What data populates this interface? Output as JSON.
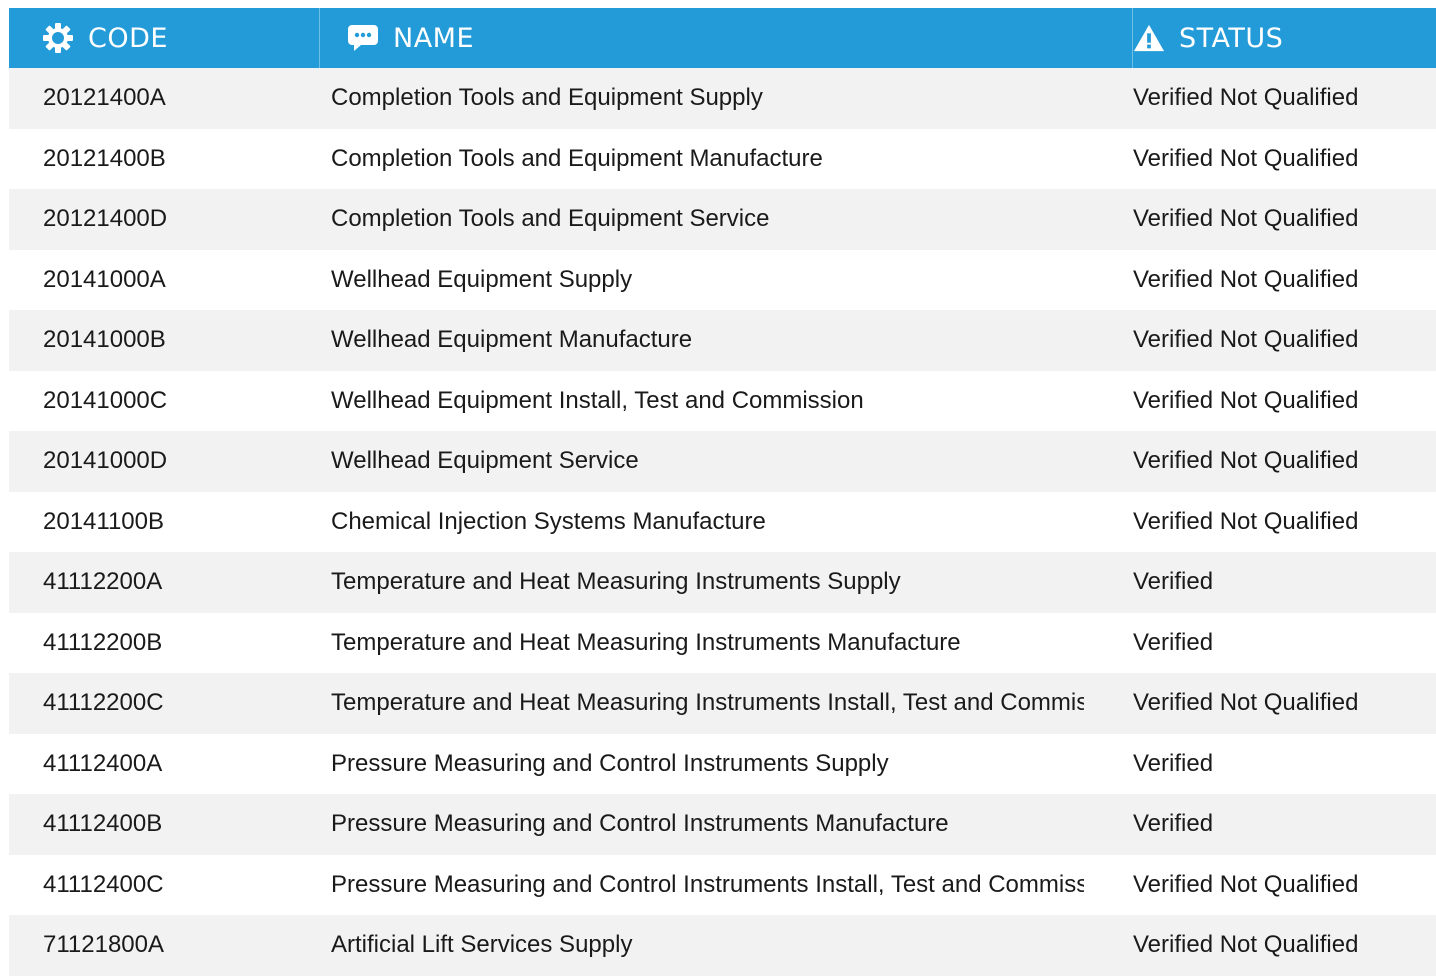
{
  "header": {
    "code_label": "CODE",
    "name_label": "NAME",
    "status_label": "STATUS",
    "code_icon": "gear-icon",
    "name_icon": "chat-bubble-icon",
    "status_icon": "warning-icon",
    "accent_color": "#229bd8"
  },
  "rows": [
    {
      "code": "20121400A",
      "name": "Completion Tools and Equipment Supply",
      "status": "Verified Not Qualified"
    },
    {
      "code": "20121400B",
      "name": "Completion Tools and Equipment Manufacture",
      "status": "Verified Not Qualified"
    },
    {
      "code": "20121400D",
      "name": "Completion Tools and Equipment Service",
      "status": "Verified Not Qualified"
    },
    {
      "code": "20141000A",
      "name": "Wellhead Equipment Supply",
      "status": "Verified Not Qualified"
    },
    {
      "code": "20141000B",
      "name": "Wellhead Equipment Manufacture",
      "status": "Verified Not Qualified"
    },
    {
      "code": "20141000C",
      "name": "Wellhead Equipment Install, Test and Commission",
      "status": "Verified Not Qualified"
    },
    {
      "code": "20141000D",
      "name": "Wellhead Equipment Service",
      "status": "Verified Not Qualified"
    },
    {
      "code": "20141100B",
      "name": "Chemical Injection Systems Manufacture",
      "status": "Verified Not Qualified"
    },
    {
      "code": "41112200A",
      "name": "Temperature and Heat Measuring Instruments Supply",
      "status": "Verified"
    },
    {
      "code": "41112200B",
      "name": "Temperature and Heat Measuring Instruments Manufacture",
      "status": "Verified"
    },
    {
      "code": "41112200C",
      "name": "Temperature and Heat Measuring Instruments Install, Test and Commission",
      "status": "Verified Not Qualified"
    },
    {
      "code": "41112400A",
      "name": "Pressure Measuring and Control Instruments Supply",
      "status": "Verified"
    },
    {
      "code": "41112400B",
      "name": "Pressure Measuring and Control Instruments Manufacture",
      "status": "Verified"
    },
    {
      "code": "41112400C",
      "name": "Pressure Measuring and Control Instruments Install, Test and Commission",
      "status": "Verified Not Qualified"
    },
    {
      "code": "71121800A",
      "name": "Artificial Lift Services Supply",
      "status": "Verified Not Qualified"
    }
  ]
}
